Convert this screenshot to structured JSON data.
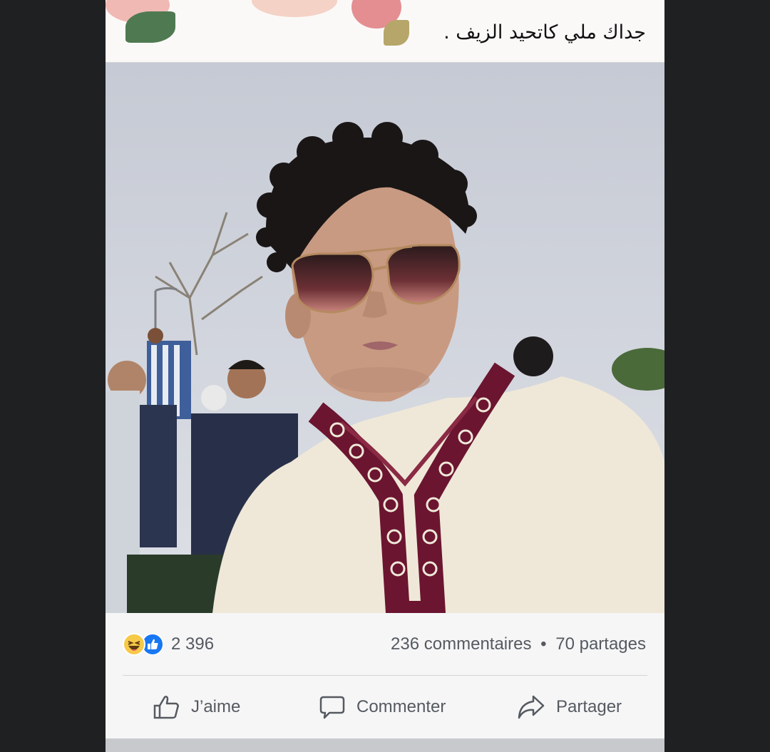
{
  "post": {
    "caption": "جداك ملي كاتحيد الزيف .",
    "photo_description": "",
    "reactions": {
      "icons": [
        "haha-icon",
        "like-icon"
      ],
      "count": "2 396"
    },
    "comments_label": "236 commentaires",
    "separator": "•",
    "shares_label": "70 partages",
    "actions": {
      "like": "J’aime",
      "comment": "Commenter",
      "share": "Partager"
    }
  },
  "colors": {
    "like_blue": "#1877f2",
    "haha_yellow": "#f7c948",
    "text_gray": "#555a60",
    "side_background": "#1f2022"
  }
}
